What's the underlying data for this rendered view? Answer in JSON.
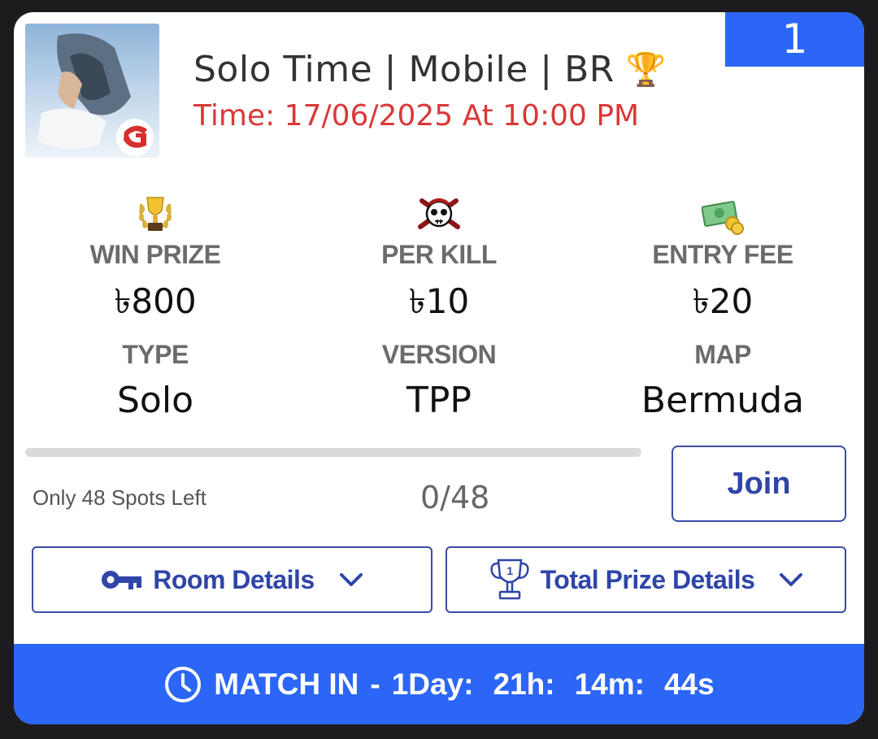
{
  "header": {
    "position_number": "1",
    "title": "Solo Time | Mobile | BR",
    "title_icon": "trophy-icon",
    "time": "Time: 17/06/2025 At 10:00 PM"
  },
  "stats": {
    "win_prize": {
      "label": "WIN PRIZE",
      "value": "৳800",
      "icon": "trophy-laurel-icon"
    },
    "per_kill": {
      "label": "PER KILL",
      "value": "৳10",
      "icon": "skull-icon"
    },
    "entry_fee": {
      "label": "ENTRY FEE",
      "value": "৳20",
      "icon": "money-icon"
    }
  },
  "info": {
    "type": {
      "label": "TYPE",
      "value": "Solo"
    },
    "version": {
      "label": "VERSION",
      "value": "TPP"
    },
    "map": {
      "label": "MAP",
      "value": "Bermuda"
    }
  },
  "progress": {
    "fraction": 0,
    "spots_left": "Only 48 Spots Left",
    "count": "0/48"
  },
  "join_label": "Join",
  "buttons": {
    "room_details": "Room Details",
    "total_prize_details": "Total Prize Details"
  },
  "footer": {
    "label": "MATCH IN",
    "separator": "-",
    "days": "1Day:",
    "hours": "21h:",
    "minutes": "14m:",
    "seconds": "44s"
  },
  "colors": {
    "accent": "#2b66f6",
    "button_border": "#3a4ca8",
    "time_red": "#d93838"
  }
}
